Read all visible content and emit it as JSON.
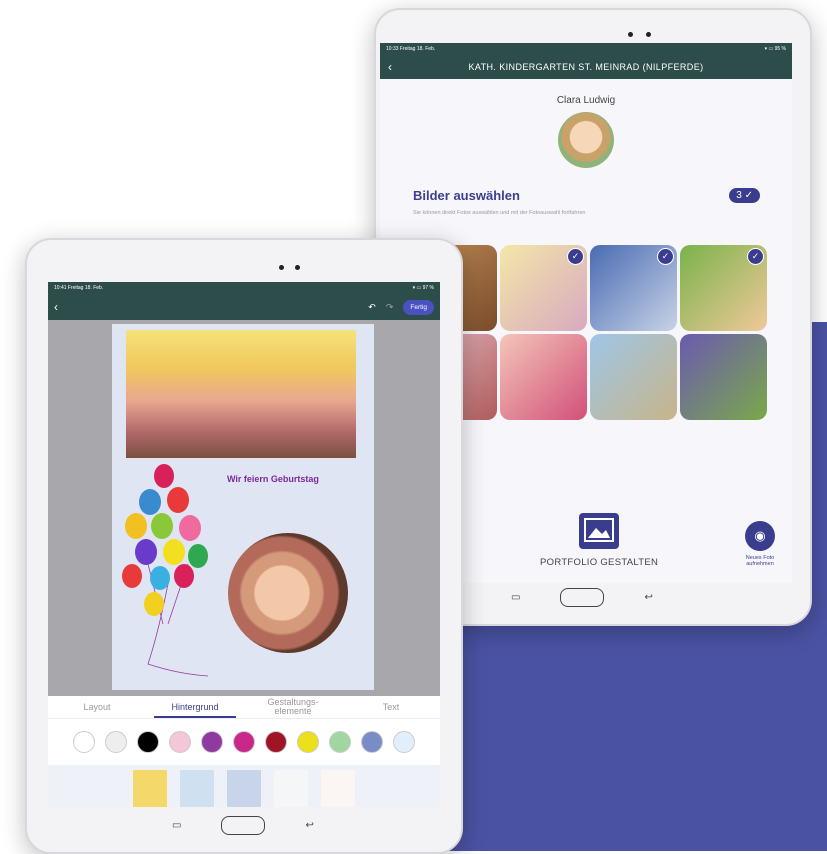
{
  "back_tablet": {
    "status": {
      "time": "10:33",
      "date": "Freitag 18. Feb.",
      "battery": "95 %"
    },
    "header_title": "KATH. KINDERGARTEN ST. MEINRAD (NILPFERDE)",
    "child_name": "Clara Ludwig",
    "select_title": "Bilder auswählen",
    "selected_count": "3 ✓",
    "select_hint": "Sie können direkt Fotos auswählen und mit der Fotoauswahl fortfahren",
    "thumbnails": [
      {
        "colors": "#c7925a,#7a4b2a",
        "checked": false
      },
      {
        "colors": "#f3e7a8,#d8a9c0",
        "checked": true
      },
      {
        "colors": "#4a6bb3,#c7d3e6",
        "checked": true
      },
      {
        "colors": "#7ab34a,#f0c89a",
        "checked": true
      },
      {
        "colors": "#e8c0c8,#b05a5a",
        "checked": false
      },
      {
        "colors": "#f4c6b8,#d2507a",
        "checked": false
      },
      {
        "colors": "#9ec6e8,#c8b48a",
        "checked": false
      },
      {
        "colors": "#6b5ab0,#7aa84a",
        "checked": false
      }
    ],
    "portfolio_label": "PORTFOLIO GESTALTEN",
    "new_photo_label": "Neues Foto aufnehmen"
  },
  "front_tablet": {
    "status": {
      "time": "10:41",
      "date": "Freitag 18. Feb.",
      "battery": "97 %"
    },
    "done_label": "Fertig",
    "page_title": "Wir feiern Geburtstag",
    "tabs": [
      "Layout",
      "Hintergrund",
      "Gestaltungs-\nelemente",
      "Text"
    ],
    "active_tab": "Hintergrund",
    "swatches": [
      "#ffffff",
      "#eeeeee",
      "#000000",
      "#f3c6d8",
      "#8e3aa0",
      "#c8288a",
      "#a01428",
      "#ece01a",
      "#a2d6a0",
      "#7a8cc6",
      "#e2eefa"
    ],
    "patterns": [
      "#f5d86a",
      "#cfe0f0",
      "#c8d4ea",
      "#f4f6f8",
      "#fbf6f4"
    ]
  }
}
